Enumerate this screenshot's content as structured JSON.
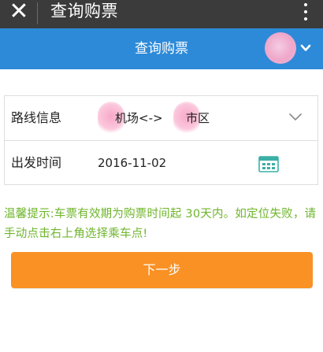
{
  "titlebar": {
    "close_icon": "close-icon",
    "title": "查询购票",
    "more_icon": "more-vertical-icon"
  },
  "header": {
    "title": "查询购票",
    "avatar_color": "#f9a8c9",
    "menu_icon": "chevron-down-icon",
    "background": "#2d8ad8"
  },
  "form": {
    "route": {
      "label": "路线信息",
      "origin_suffix": "机场<->",
      "destination_suffix": "市区",
      "dropdown_icon": "chevron-down-icon"
    },
    "departure": {
      "label": "出发时间",
      "value": "2016-11-02",
      "calendar_icon": "calendar-icon"
    }
  },
  "tip": {
    "text": "温馨提示:车票有效期为购票时间起 30天内。如定位失败，请手动点击右上角选择乘车点!",
    "color": "#6fb52c"
  },
  "next_button": {
    "label": "下一步",
    "color": "#f99124"
  }
}
